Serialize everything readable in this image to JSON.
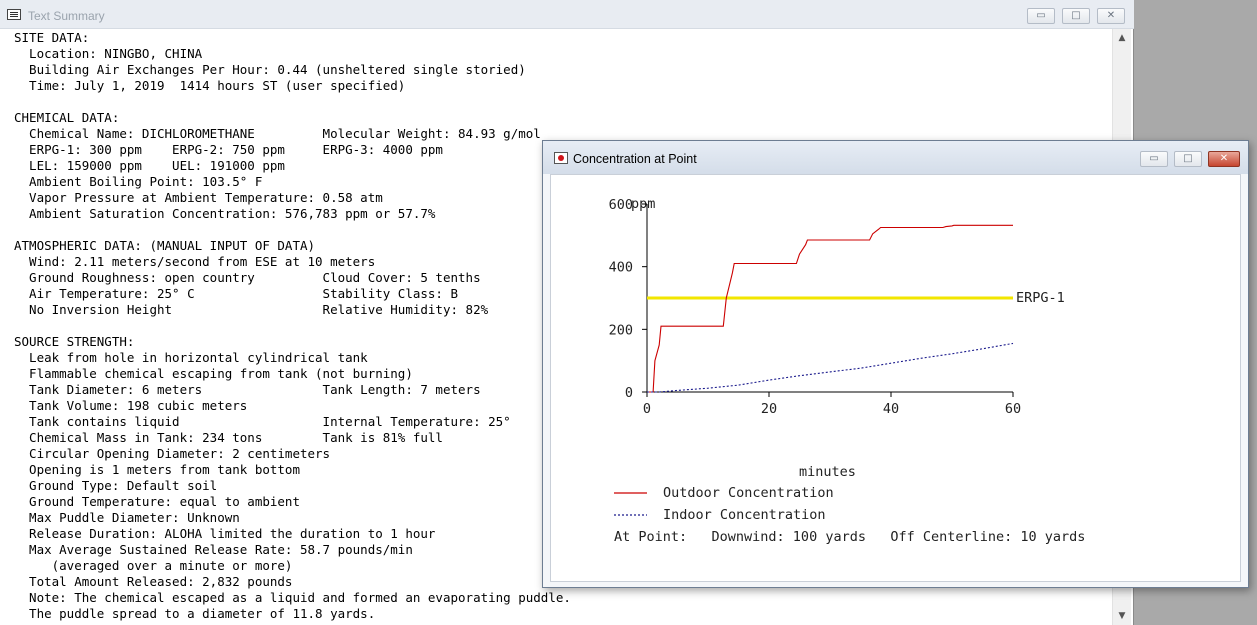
{
  "summary_window": {
    "title": "Text Summary",
    "lines": [
      "SITE DATA:",
      "  Location: NINGBO, CHINA",
      "  Building Air Exchanges Per Hour: 0.44 (unsheltered single storied)",
      "  Time: July 1, 2019  1414 hours ST (user specified)",
      "",
      "CHEMICAL DATA:",
      "  Chemical Name: DICHLOROMETHANE         Molecular Weight: 84.93 g/mol",
      "  ERPG-1: 300 ppm    ERPG-2: 750 ppm     ERPG-3: 4000 ppm",
      "  LEL: 159000 ppm    UEL: 191000 ppm",
      "  Ambient Boiling Point: 103.5° F",
      "  Vapor Pressure at Ambient Temperature: 0.58 atm",
      "  Ambient Saturation Concentration: 576,783 ppm or 57.7%",
      "",
      "ATMOSPHERIC DATA: (MANUAL INPUT OF DATA)",
      "  Wind: 2.11 meters/second from ESE at 10 meters",
      "  Ground Roughness: open country         Cloud Cover: 5 tenths",
      "  Air Temperature: 25° C                 Stability Class: B",
      "  No Inversion Height                    Relative Humidity: 82%",
      "",
      "SOURCE STRENGTH:",
      "  Leak from hole in horizontal cylindrical tank",
      "  Flammable chemical escaping from tank (not burning)",
      "  Tank Diameter: 6 meters                Tank Length: 7 meters",
      "  Tank Volume: 198 cubic meters",
      "  Tank contains liquid                   Internal Temperature: 25°",
      "  Chemical Mass in Tank: 234 tons        Tank is 81% full",
      "  Circular Opening Diameter: 2 centimeters",
      "  Opening is 1 meters from tank bottom",
      "  Ground Type: Default soil",
      "  Ground Temperature: equal to ambient",
      "  Max Puddle Diameter: Unknown",
      "  Release Duration: ALOHA limited the duration to 1 hour",
      "  Max Average Sustained Release Rate: 58.7 pounds/min",
      "     (averaged over a minute or more)",
      "  Total Amount Released: 2,832 pounds",
      "  Note: The chemical escaped as a liquid and formed an evaporating puddle.",
      "  The puddle spread to a diameter of 11.8 yards."
    ],
    "buttons": {
      "minimize": "▭",
      "maximize": "□",
      "close": "✕"
    },
    "scroll": {
      "up": "▲",
      "down": "▼"
    }
  },
  "plot_window": {
    "title": "Concentration at Point",
    "buttons": {
      "minimize": "▭",
      "maximize": "□",
      "close": "✕"
    },
    "legend": {
      "outdoor": "Outdoor Concentration",
      "indoor": "Indoor Concentration"
    },
    "at_point": "At Point:   Downwind: 100 yards   Off Centerline: 10 yards"
  },
  "chart_data": {
    "type": "line",
    "ylabel": "ppm",
    "xlabel": "minutes",
    "xlim": [
      0,
      60
    ],
    "ylim": [
      0,
      600
    ],
    "xticks": [
      0,
      20,
      40,
      60
    ],
    "yticks": [
      0,
      200,
      400,
      600
    ],
    "threshold": {
      "label": "ERPG-1",
      "value": 300,
      "color": "#f2e600"
    },
    "series": [
      {
        "key": "outdoor",
        "color": "#cc0000",
        "style": "solid",
        "x": [
          0,
          1,
          1.3,
          2,
          2.3,
          12.5,
          13,
          14,
          14.3,
          24.5,
          25,
          26,
          26.3,
          36.5,
          37,
          38,
          38.3,
          48.5,
          49,
          50,
          50.3,
          60
        ],
        "y": [
          0,
          0,
          100,
          150,
          210,
          210,
          300,
          380,
          410,
          410,
          440,
          470,
          485,
          485,
          505,
          520,
          525,
          525,
          528,
          530,
          532,
          532
        ]
      },
      {
        "key": "indoor",
        "color": "#1a1a8c",
        "style": "dotted",
        "x": [
          0,
          2,
          5,
          10,
          15,
          20,
          25,
          30,
          35,
          40,
          45,
          50,
          55,
          60
        ],
        "y": [
          0,
          0,
          5,
          12,
          22,
          38,
          52,
          64,
          76,
          92,
          108,
          122,
          138,
          155
        ]
      }
    ]
  }
}
